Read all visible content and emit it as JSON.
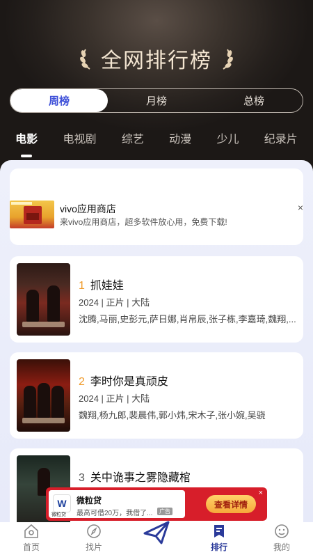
{
  "header": {
    "title": "全网排行榜"
  },
  "period_tabs": [
    "周榜",
    "月榜",
    "总榜"
  ],
  "period_active": 0,
  "categories": [
    "电影",
    "电视剧",
    "综艺",
    "动漫",
    "少儿",
    "纪录片"
  ],
  "category_active": 0,
  "ad": {
    "title": "vivo应用商店",
    "description": "来vivo应用商店，超多软件放心用，免费下载!",
    "close": "×"
  },
  "movies": [
    {
      "rank": "1",
      "title": "抓娃娃",
      "meta": "2024 | 正片 | 大陆",
      "cast": "沈腾,马丽,史彭元,萨日娜,肖帛辰,张子栋,李嘉琦,魏翔,..."
    },
    {
      "rank": "2",
      "title": "李时你是真顽皮",
      "meta": "2024 | 正片 | 大陆",
      "cast": "魏翔,杨九郎,裴晨伟,郭小炜,宋木子,张小婉,吴骁"
    },
    {
      "rank": "3",
      "title": "关中诡事之雾隐藏棺",
      "meta": "",
      "cast": ""
    }
  ],
  "banner_ad": {
    "logo_label": "微粒贷",
    "title": "微粒贷",
    "subtitle": "最高可借20万，我借了...",
    "tag": "广告",
    "button": "查看详情",
    "close": "×"
  },
  "tabbar": [
    "首页",
    "找片",
    "",
    "排行",
    "我的"
  ],
  "tabbar_active": 3,
  "colors": {
    "accent": "#3d4fd8",
    "rank_highlight": "#ef9a2a",
    "ad_red": "#d71e2a"
  }
}
